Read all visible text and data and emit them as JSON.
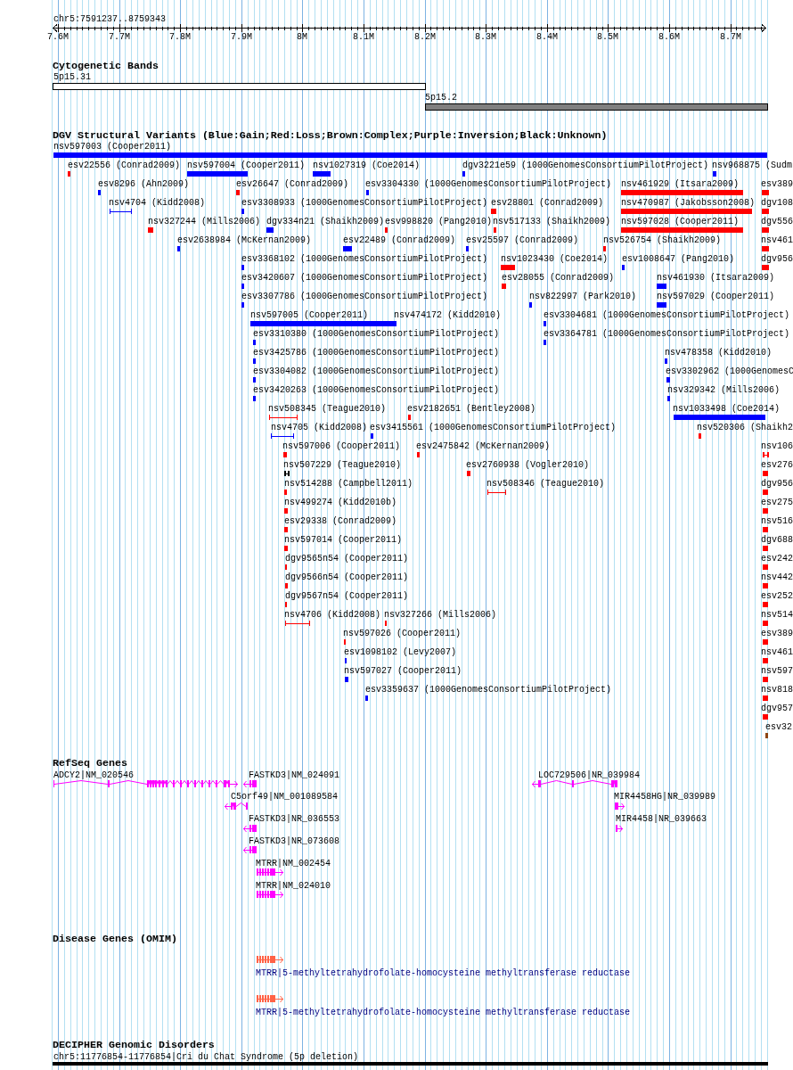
{
  "ruler": {
    "region": "chr5:7591237..8759343",
    "ticks": [
      "7.6M",
      "7.7M",
      "7.8M",
      "7.9M",
      "8M",
      "8.1M",
      "8.2M",
      "8.3M",
      "8.4M",
      "8.5M",
      "8.6M",
      "8.7M"
    ]
  },
  "cytogenetic_bands": {
    "title": "Cytogenetic Bands",
    "bands": [
      {
        "label": "5p15.31",
        "color": "#ffffff"
      },
      {
        "label": "5p15.2",
        "color": "#808080"
      }
    ]
  },
  "dgv_structural_variants": {
    "title": "DGV Structural Variants (Blue:Gain;Red:Loss;Brown:Complex;Purple:Inversion;Black:Unknown)",
    "rows": [
      {
        "features": [
          {
            "label": "nsv597003 (Cooper2011)",
            "color": "#0000ff",
            "kind": "block"
          }
        ]
      },
      {
        "features": [
          {
            "label": "esv22556 (Conrad2009)",
            "color": "#ff0000",
            "kind": "block"
          },
          {
            "label": "nsv597004 (Cooper2011)",
            "color": "#0000ff",
            "kind": "block"
          },
          {
            "label": "nsv1027319 (Coe2014)",
            "color": "#0000ff",
            "kind": "block"
          },
          {
            "label": "dgv3221e59 (1000GenomesConsortiumPilotProject)",
            "color": "#0000ff",
            "kind": "block"
          },
          {
            "label": "nsv968875 (Sudm",
            "color": "#0000ff",
            "kind": "block"
          }
        ]
      },
      {
        "features": [
          {
            "label": "esv8296 (Ahn2009)",
            "color": "#0000ff",
            "kind": "block"
          },
          {
            "label": "esv26647 (Conrad2009)",
            "color": "#ff0000",
            "kind": "block"
          },
          {
            "label": "esv3304330 (1000GenomesConsortiumPilotProject)",
            "color": "#0000ff",
            "kind": "block"
          },
          {
            "label": "nsv461929 (Itsara2009)",
            "color": "#ff0000",
            "kind": "block"
          },
          {
            "label": "esv389",
            "color": "#ff0000",
            "kind": "block"
          }
        ]
      },
      {
        "features": [
          {
            "label": "nsv4704 (Kidd2008)",
            "color": "#0000ff",
            "kind": "range"
          },
          {
            "label": "esv3308933 (1000GenomesConsortiumPilotProject)",
            "color": "#0000ff",
            "kind": "block"
          },
          {
            "label": "esv28801 (Conrad2009)",
            "color": "#ff0000",
            "kind": "block"
          },
          {
            "label": "nsv470987 (Jakobsson2008)",
            "color": "#ff0000",
            "kind": "block"
          },
          {
            "label": "dgv108",
            "color": "#ff0000",
            "kind": "block"
          }
        ]
      },
      {
        "features": [
          {
            "label": "nsv327244 (Mills2006)",
            "color": "#ff0000",
            "kind": "block"
          },
          {
            "label": "dgv334n21 (Shaikh2009)",
            "color": "#0000ff",
            "kind": "block"
          },
          {
            "label": "esv998820 (Pang2010)",
            "color": "#ff0000",
            "kind": "block"
          },
          {
            "label": "nsv517133 (Shaikh2009)",
            "color": "#ff0000",
            "kind": "block"
          },
          {
            "label": "nsv597028 (Cooper2011)",
            "color": "#ff0000",
            "kind": "block"
          },
          {
            "label": "dgv556",
            "color": "#ff0000",
            "kind": "block"
          }
        ]
      },
      {
        "features": [
          {
            "label": "esv2638984 (McKernan2009)",
            "color": "#0000ff",
            "kind": "block"
          },
          {
            "label": "esv22489 (Conrad2009)",
            "color": "#0000ff",
            "kind": "block"
          },
          {
            "label": "esv25597 (Conrad2009)",
            "color": "#0000ff",
            "kind": "block"
          },
          {
            "label": "nsv526754 (Shaikh2009)",
            "color": "#ff0000",
            "kind": "block"
          },
          {
            "label": "nsv461",
            "color": "#ff0000",
            "kind": "block"
          }
        ]
      },
      {
        "features": [
          {
            "label": "esv3368102 (1000GenomesConsortiumPilotProject)",
            "color": "#0000ff",
            "kind": "block"
          },
          {
            "label": "nsv1023430 (Coe2014)",
            "color": "#ff0000",
            "kind": "block"
          },
          {
            "label": "esv1008647 (Pang2010)",
            "color": "#0000ff",
            "kind": "block"
          },
          {
            "label": "dgv956",
            "color": "#ff0000",
            "kind": "block"
          }
        ]
      },
      {
        "features": [
          {
            "label": "esv3420607 (1000GenomesConsortiumPilotProject)",
            "color": "#0000ff",
            "kind": "block"
          },
          {
            "label": "esv28055 (Conrad2009)",
            "color": "#ff0000",
            "kind": "block"
          },
          {
            "label": "nsv461930 (Itsara2009)",
            "color": "#0000ff",
            "kind": "block"
          }
        ]
      },
      {
        "features": [
          {
            "label": "esv3307786 (1000GenomesConsortiumPilotProject)",
            "color": "#0000ff",
            "kind": "block"
          },
          {
            "label": "nsv822997 (Park2010)",
            "color": "#0000ff",
            "kind": "block"
          },
          {
            "label": "nsv597029 (Cooper2011)",
            "color": "#0000ff",
            "kind": "block"
          }
        ]
      },
      {
        "features": [
          {
            "label": "nsv597005 (Cooper2011)",
            "color": "#0000ff",
            "kind": "block"
          },
          {
            "label": "nsv474172 (Kidd2010)",
            "color": "#0000ff",
            "kind": "block"
          },
          {
            "label": "esv3304681 (1000GenomesConsortiumPilotProject)",
            "color": "#0000ff",
            "kind": "block"
          }
        ]
      },
      {
        "features": [
          {
            "label": "esv3310380 (1000GenomesConsortiumPilotProject)",
            "color": "#0000ff",
            "kind": "block"
          },
          {
            "label": "esv3364781 (1000GenomesConsortiumPilotProject)",
            "color": "#0000ff",
            "kind": "block"
          }
        ]
      },
      {
        "features": [
          {
            "label": "esv3425786 (1000GenomesConsortiumPilotProject)",
            "color": "#0000ff",
            "kind": "block"
          },
          {
            "label": "nsv478358 (Kidd2010)",
            "color": "#0000ff",
            "kind": "block"
          }
        ]
      },
      {
        "features": [
          {
            "label": "esv3304082 (1000GenomesConsortiumPilotProject)",
            "color": "#0000ff",
            "kind": "block"
          },
          {
            "label": "esv3302962 (1000GenomesC",
            "color": "#0000ff",
            "kind": "block"
          }
        ]
      },
      {
        "features": [
          {
            "label": "esv3420263 (1000GenomesConsortiumPilotProject)",
            "color": "#0000ff",
            "kind": "block"
          },
          {
            "label": "nsv329342 (Mills2006)",
            "color": "#0000ff",
            "kind": "block"
          }
        ]
      },
      {
        "features": [
          {
            "label": "nsv508345 (Teague2010)",
            "color": "#ff0000",
            "kind": "range"
          },
          {
            "label": "esv2182651 (Bentley2008)",
            "color": "#ff0000",
            "kind": "block"
          },
          {
            "label": "nsv1033498 (Coe2014)",
            "color": "#0000ff",
            "kind": "block"
          }
        ]
      },
      {
        "features": [
          {
            "label": "nsv4705 (Kidd2008)",
            "color": "#0000ff",
            "kind": "range"
          },
          {
            "label": "esv3415561 (1000GenomesConsortiumPilotProject)",
            "color": "#0000ff",
            "kind": "block"
          },
          {
            "label": "nsv520306 (Shaikh2",
            "color": "#ff0000",
            "kind": "block"
          }
        ]
      },
      {
        "features": [
          {
            "label": "nsv597006 (Cooper2011)",
            "color": "#ff0000",
            "kind": "block"
          },
          {
            "label": "esv2475842 (McKernan2009)",
            "color": "#ff0000",
            "kind": "block"
          },
          {
            "label": "nsv106",
            "color": "#ff0000",
            "kind": "range"
          }
        ]
      },
      {
        "features": [
          {
            "label": "nsv507229 (Teague2010)",
            "color": "#000000",
            "kind": "range"
          },
          {
            "label": "esv2760938 (Vogler2010)",
            "color": "#ff0000",
            "kind": "block"
          },
          {
            "label": "esv276",
            "color": "#ff0000",
            "kind": "block"
          }
        ]
      },
      {
        "features": [
          {
            "label": "nsv514288 (Campbell2011)",
            "color": "#ff0000",
            "kind": "block"
          },
          {
            "label": "nsv508346 (Teague2010)",
            "color": "#ff0000",
            "kind": "range"
          },
          {
            "label": "dgv956",
            "color": "#ff0000",
            "kind": "block"
          }
        ]
      },
      {
        "features": [
          {
            "label": "nsv499274 (Kidd2010b)",
            "color": "#ff0000",
            "kind": "block"
          },
          {
            "label": "esv275",
            "color": "#ff0000",
            "kind": "block"
          }
        ]
      },
      {
        "features": [
          {
            "label": "esv29338 (Conrad2009)",
            "color": "#ff0000",
            "kind": "block"
          },
          {
            "label": "nsv516",
            "color": "#ff0000",
            "kind": "block"
          }
        ]
      },
      {
        "features": [
          {
            "label": "nsv597014 (Cooper2011)",
            "color": "#ff0000",
            "kind": "block"
          },
          {
            "label": "dgv688",
            "color": "#ff0000",
            "kind": "block"
          }
        ]
      },
      {
        "features": [
          {
            "label": "dgv9565n54 (Cooper2011)",
            "color": "#ff0000",
            "kind": "block"
          },
          {
            "label": "esv242",
            "color": "#ff0000",
            "kind": "block"
          }
        ]
      },
      {
        "features": [
          {
            "label": "dgv9566n54 (Cooper2011)",
            "color": "#ff0000",
            "kind": "block"
          },
          {
            "label": "nsv442",
            "color": "#ff0000",
            "kind": "block"
          }
        ]
      },
      {
        "features": [
          {
            "label": "dgv9567n54 (Cooper2011)",
            "color": "#ff0000",
            "kind": "block"
          },
          {
            "label": "esv252",
            "color": "#ff0000",
            "kind": "block"
          }
        ]
      },
      {
        "features": [
          {
            "label": "nsv4706 (Kidd2008)",
            "color": "#ff0000",
            "kind": "range"
          },
          {
            "label": "nsv327266 (Mills2006)",
            "color": "#ff0000",
            "kind": "block"
          },
          {
            "label": "nsv514",
            "color": "#ff0000",
            "kind": "block"
          }
        ]
      },
      {
        "features": [
          {
            "label": "nsv597026 (Cooper2011)",
            "color": "#ff0000",
            "kind": "block"
          },
          {
            "label": "esv389",
            "color": "#ff0000",
            "kind": "block"
          }
        ]
      },
      {
        "features": [
          {
            "label": "esv1098102 (Levy2007)",
            "color": "#0000ff",
            "kind": "block"
          },
          {
            "label": "nsv461",
            "color": "#ff0000",
            "kind": "block"
          }
        ]
      },
      {
        "features": [
          {
            "label": "nsv597027 (Cooper2011)",
            "color": "#0000ff",
            "kind": "block"
          },
          {
            "label": "nsv597",
            "color": "#ff0000",
            "kind": "block"
          }
        ]
      },
      {
        "features": [
          {
            "label": "esv3359637 (1000GenomesConsortiumPilotProject)",
            "color": "#0000ff",
            "kind": "block"
          },
          {
            "label": "nsv818",
            "color": "#ff0000",
            "kind": "block"
          }
        ]
      },
      {
        "features": [
          {
            "label": "dgv957",
            "color": "#ff0000",
            "kind": "block"
          }
        ]
      },
      {
        "features": [
          {
            "label": "esv32",
            "color": "#8b4513",
            "kind": "block"
          }
        ]
      }
    ]
  },
  "refseq_genes": {
    "title": "RefSeq Genes",
    "genes": [
      {
        "label": "ADCY2|NM_020546",
        "reverse": false
      },
      {
        "label": "FASTKD3|NM_024091",
        "reverse": true
      },
      {
        "label": "LOC729506|NR_039984",
        "reverse": true
      },
      {
        "label": "C5orf49|NM_001089584",
        "reverse": true
      },
      {
        "label": "MIR4458HG|NR_039989",
        "reverse": false
      },
      {
        "label": "FASTKD3|NR_036553",
        "reverse": true
      },
      {
        "label": "MIR4458|NR_039663",
        "reverse": false
      },
      {
        "label": "FASTKD3|NR_073608",
        "reverse": true
      },
      {
        "label": "MTRR|NM_002454",
        "reverse": false
      },
      {
        "label": "MTRR|NM_024010",
        "reverse": false
      }
    ]
  },
  "disease_genes_omim": {
    "title": "Disease Genes (OMIM)",
    "genes": [
      {
        "label": "MTRR|5-methyltetrahydrofolate-homocysteine methyltransferase reductase"
      },
      {
        "label": "MTRR|5-methyltetrahydrofolate-homocysteine methyltransferase reductase"
      }
    ]
  },
  "decipher_genomic_disorders": {
    "title": "DECIPHER Genomic Disorders",
    "disorders": [
      {
        "label": "chr5:11776854-11776854|Cri du Chat Syndrome (5p deletion)"
      }
    ]
  }
}
